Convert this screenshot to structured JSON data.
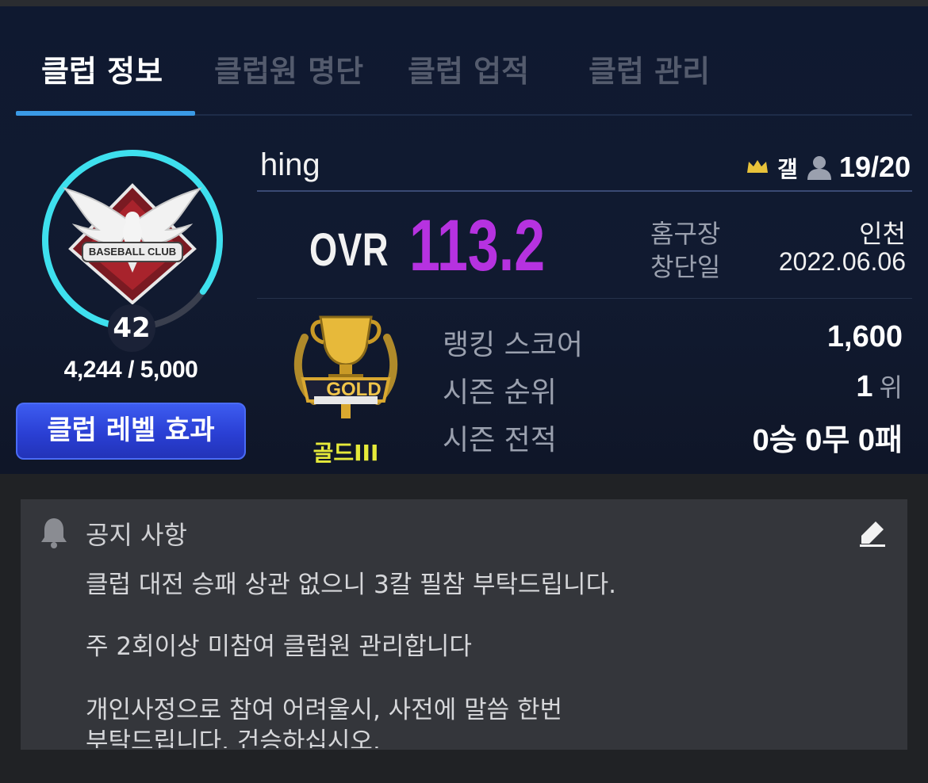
{
  "tabs": [
    {
      "label": "클럽 정보",
      "active": true
    },
    {
      "label": "클럽원 명단",
      "active": false
    },
    {
      "label": "클럽 업적",
      "active": false
    },
    {
      "label": "클럽 관리",
      "active": false
    }
  ],
  "club": {
    "name": "hing",
    "emblem_text": "BASEBALL CLUB",
    "leader": "갤",
    "members": "19/20",
    "level": "42",
    "exp": "4,244 / 5,000",
    "exp_progress": 0.85,
    "level_button": "클럽 레벨 효과"
  },
  "ovr": {
    "label": "OVR",
    "value": "113.2"
  },
  "info": {
    "home_label": "홈구장",
    "home_value": "인천",
    "founded_label": "창단일",
    "founded_value": "2022.06.06"
  },
  "tier": {
    "badge_text": "GOLD",
    "name": "골드III"
  },
  "stats": {
    "ranking_label": "랭킹 스코어",
    "ranking_value": "1,600",
    "rank_label": "시즌 순위",
    "rank_value": "1",
    "rank_unit": "위",
    "record_label": "시즌 전적",
    "record_value": "0승 0무 0패"
  },
  "notice": {
    "title": "공지 사항",
    "lines": [
      "클럽 대전 승패 상관 없으니 3칼 필참 부탁드립니다.",
      "주 2회이상 미참여 클럽원 관리합니다",
      "개인사정으로 참여 어려울시, 사전에 말씀 한번",
      "부탁드립니다. 건승하십시오."
    ]
  },
  "colors": {
    "accent_blue": "#3a9ae6",
    "ovr_purple": "#b632e0",
    "ring_cyan": "#3ee0ee",
    "tier_yellow": "#e6ea3a",
    "button_blue": "#2a3fd4"
  }
}
